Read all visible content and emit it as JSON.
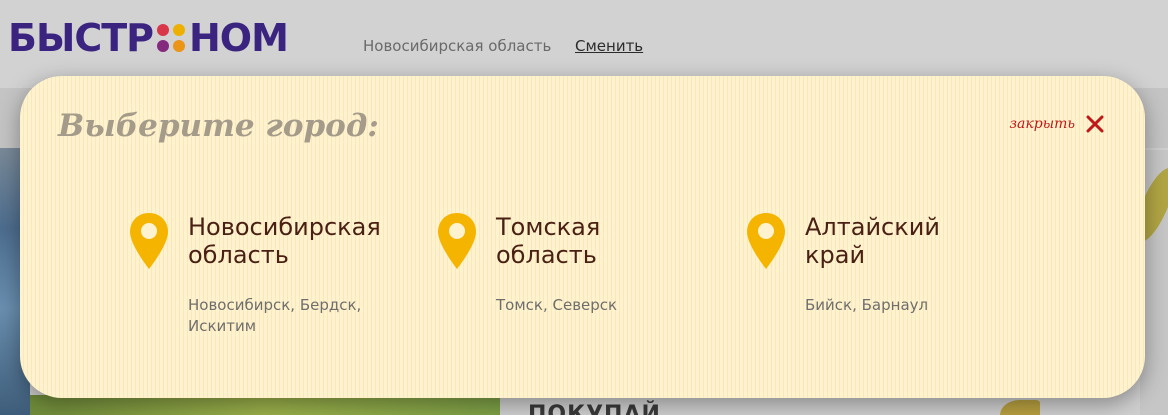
{
  "header": {
    "logo": {
      "left": "БЫСТР",
      "right": "НОМ",
      "dot_colors": [
        "#e23b4a",
        "#f6b800",
        "#8b2a83",
        "#f39b1b"
      ]
    },
    "current_region": "Новосибирская область",
    "change_label": "Сменить"
  },
  "background": {
    "bottom_text": "ПОКУПАЙ"
  },
  "modal": {
    "title": "Выберите город:",
    "close_label": "закрыть",
    "close_icon": "close-icon",
    "pin_icon": "map-pin-icon",
    "regions": [
      {
        "name_line1": "Новосибирская",
        "name_line2": "область",
        "cities_line1": "Новосибирск, Бердск,",
        "cities_line2": "Искитим"
      },
      {
        "name_line1": "Томская",
        "name_line2": "область",
        "cities_line1": "Томск, Северск",
        "cities_line2": ""
      },
      {
        "name_line1": "Алтайский",
        "name_line2": "край",
        "cities_line1": "Бийск, Барнаул",
        "cities_line2": ""
      }
    ]
  },
  "colors": {
    "brand": "#3b2480",
    "modal_bg": "#fff3cf",
    "pin": "#f5b400",
    "close": "#c01818",
    "region_name": "#4a1f14"
  }
}
